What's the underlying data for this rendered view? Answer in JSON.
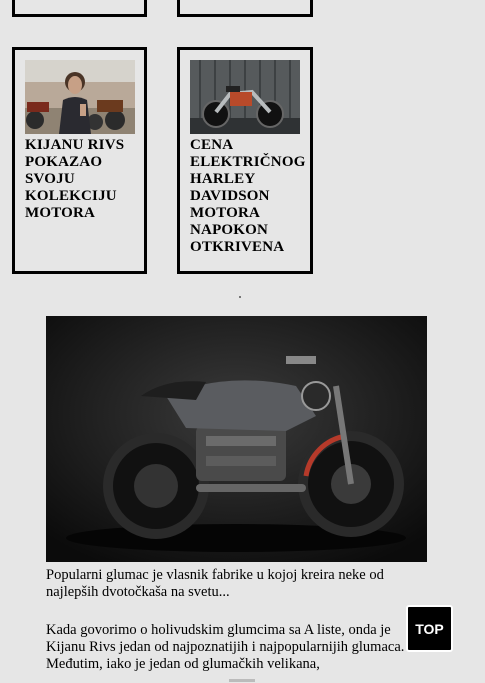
{
  "cards": [
    {
      "title": "KIJANU RIVS POKAZAO SVOJU KOLEKCIJU MOTORA",
      "thumb_icon": "keanu-with-motorcycles-photo"
    },
    {
      "title": "CENA ELEKTRIČNOG HARLEY DAVIDSON MOTORA NAPOKON OTKRIVENA",
      "thumb_icon": "electric-harley-photo"
    }
  ],
  "article": {
    "hero_icon": "black-motorcycle-photo",
    "para1": "Popularni glumac je vlasnik fabrike u kojoj kreira neke od najlepših dvotočkaša na svetu...",
    "para2": "Kada govorimo o holivudskim glumcima sa A liste, onda je Kijanu Rivs jedan od najpoznatijih i najpopularnijih glumaca. Međutim, iako je jedan od glumačkih velikana,"
  },
  "top_button": {
    "label": "TOP"
  }
}
